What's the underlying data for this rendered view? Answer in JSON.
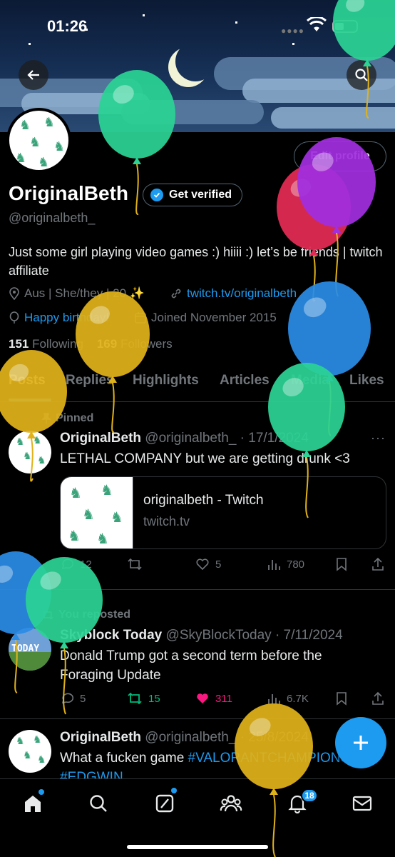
{
  "status_bar": {
    "time": "01:26"
  },
  "profile": {
    "edit_label": "Edit profile",
    "display_name": "OriginalBeth",
    "get_verified_label": "Get verified",
    "handle": "@originalbeth_",
    "bio": "Just some girl playing video games :) hiiii :) let’s be friends | twitch affiliate",
    "location": "Aus | She/they | 20 ✨",
    "website": "twitch.tv/originalbeth",
    "birthday": "Happy birthday!",
    "joined": "Joined November 2015",
    "following_count": "151",
    "following_label": "Following",
    "followers_count": "169",
    "followers_label": "Followers"
  },
  "tabs": [
    {
      "label": "Posts"
    },
    {
      "label": "Replies"
    },
    {
      "label": "Highlights"
    },
    {
      "label": "Articles"
    },
    {
      "label": "Media"
    },
    {
      "label": "Likes"
    }
  ],
  "posts": [
    {
      "context": "Pinned",
      "author": "OriginalBeth",
      "meta": "@originalbeth_ · 17/1/2024",
      "text": "LETHAL COMPANY but we are getting drunk <3",
      "card_title": "originalbeth - Twitch",
      "card_url": "twitch.tv",
      "replies": "12",
      "reposts": "",
      "likes": "5",
      "views": "780"
    },
    {
      "context": "You reposted",
      "author": "Skyblock Today",
      "meta": "@SkyBlockToday · 7/11/2024",
      "avatar_text": "TODAY",
      "text": "Donald Trump got a second term before the Foraging Update",
      "replies": "5",
      "reposts": "15",
      "likes": "311",
      "views": "6.7K"
    },
    {
      "author": "OriginalBeth",
      "meta": "@originalbeth_ · 25/8/2024",
      "text_plain": "What a fucken game ",
      "tag1": "#VALORANTCHAMPIONS",
      "tag2": "#EDGWIN"
    }
  ],
  "nav": {
    "notifications_badge": "18"
  },
  "colors": {
    "accent": "#1d9bf0",
    "like_active": "#f91880",
    "repost_active": "#00ba7c",
    "balloon_green": "#2bd394",
    "balloon_red": "#e52b55",
    "balloon_purple": "#a12ee0",
    "balloon_blue": "#2a8ce6",
    "balloon_yellow": "#e0b21a"
  }
}
